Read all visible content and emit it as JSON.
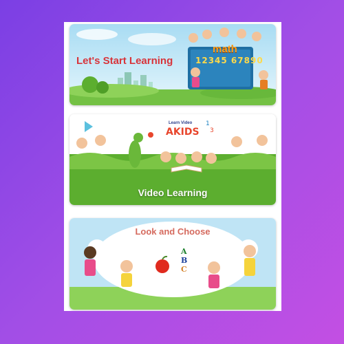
{
  "cards": [
    {
      "title": "Let's Start Learning",
      "badge": "math",
      "numbers": "12345 67890"
    },
    {
      "title": "Video Learning",
      "badge_small": "Learn Video",
      "badge_big": "AKIDS"
    },
    {
      "title": "Look and Choose",
      "letters": [
        "A",
        "B",
        "C"
      ]
    }
  ],
  "colors": {
    "accent_red": "#d8343a",
    "grass_green": "#5cae2f",
    "sky_blue": "#bfe4f5"
  }
}
